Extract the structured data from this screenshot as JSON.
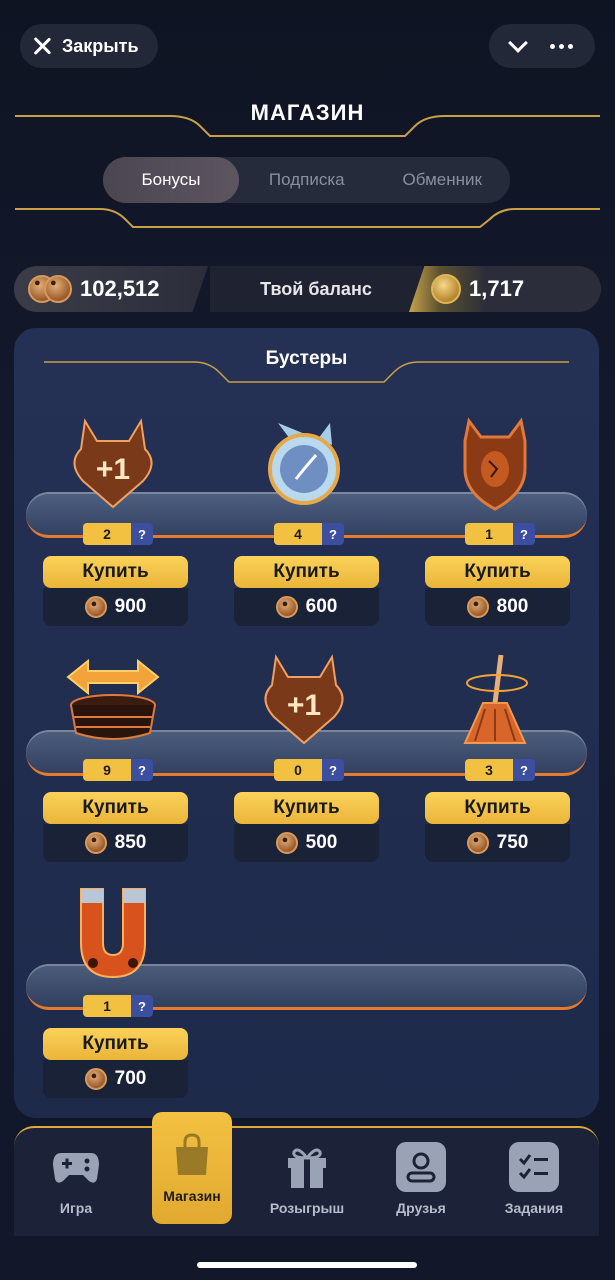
{
  "topbar": {
    "close_label": "Закрыть"
  },
  "title": "МАГАЗИН",
  "tabs": [
    {
      "label": "Бонусы",
      "active": true
    },
    {
      "label": "Подписка",
      "active": false
    },
    {
      "label": "Обменник",
      "active": false
    }
  ],
  "balance": {
    "paw_amount": "102,512",
    "label": "Твой баланс",
    "gold_amount": "1,717"
  },
  "boosters": {
    "title": "Бустеры",
    "buy_label": "Купить",
    "items": [
      {
        "icon": "heart-plus-one-icon",
        "count": "2",
        "price": "900"
      },
      {
        "icon": "frozen-clock-icon",
        "count": "4",
        "price": "600"
      },
      {
        "icon": "shield-icon",
        "count": "1",
        "price": "800"
      },
      {
        "icon": "arrows-basket-icon",
        "count": "9",
        "price": "850"
      },
      {
        "icon": "heart-plus-one-icon",
        "count": "0",
        "price": "500"
      },
      {
        "icon": "broom-icon",
        "count": "3",
        "price": "750"
      },
      {
        "icon": "magnet-icon",
        "count": "1",
        "price": "700"
      }
    ]
  },
  "nav": [
    {
      "label": "Игра",
      "icon": "gamepad-icon",
      "active": false
    },
    {
      "label": "Магазин",
      "icon": "shopping-bag-icon",
      "active": true
    },
    {
      "label": "Розыгрыш",
      "icon": "gift-icon",
      "active": false
    },
    {
      "label": "Друзья",
      "icon": "user-icon",
      "active": false
    },
    {
      "label": "Задания",
      "icon": "checklist-icon",
      "active": false
    }
  ],
  "colors": {
    "accent": "#f3c142",
    "orange": "#e67a2c",
    "panel": "#243155"
  }
}
